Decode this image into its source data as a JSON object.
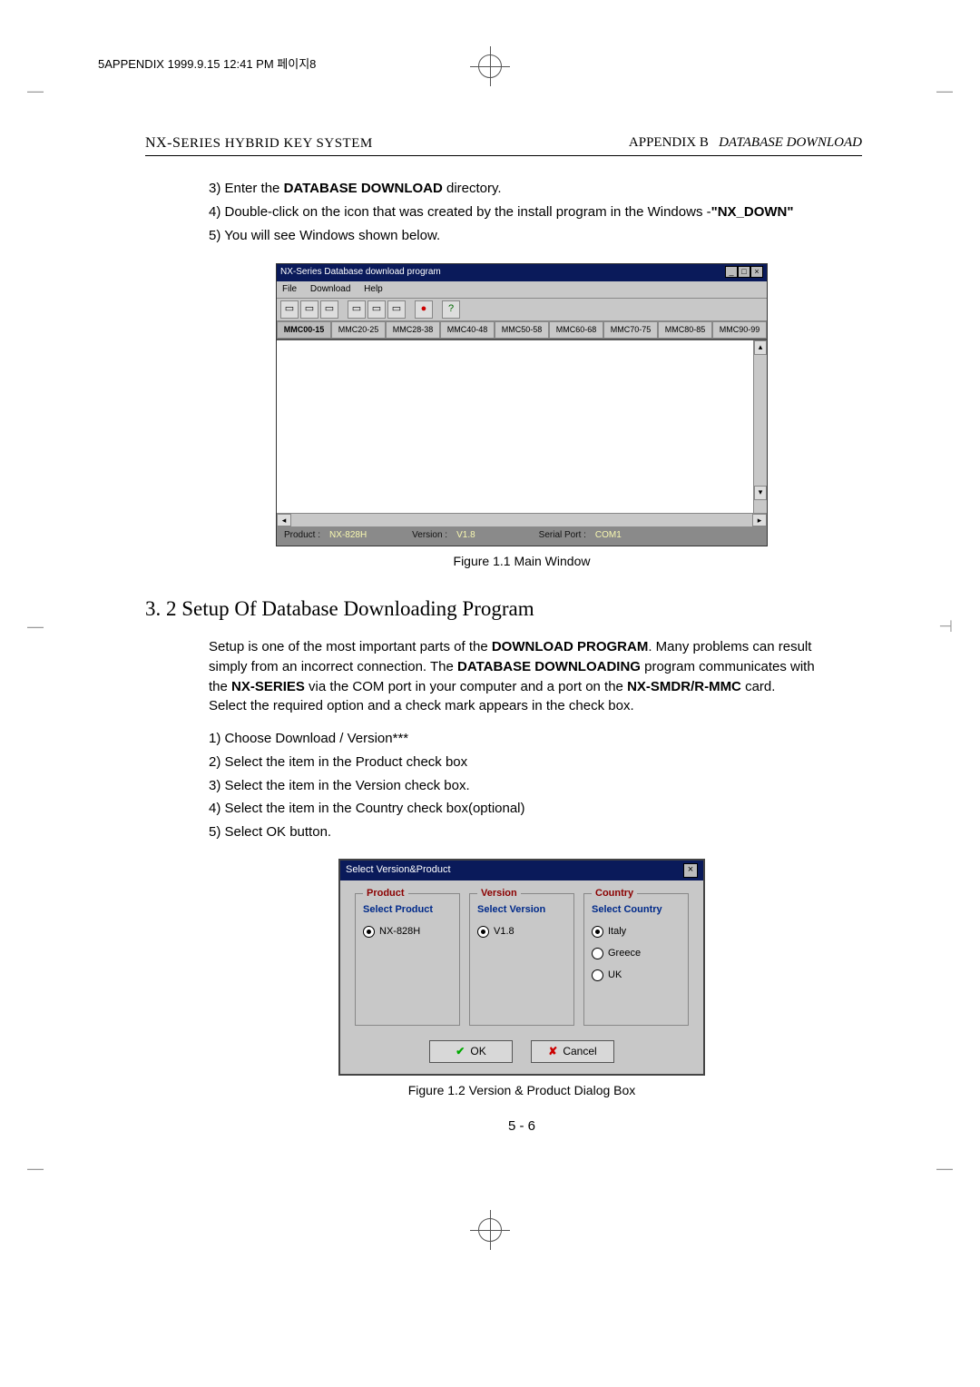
{
  "folio": "5APPENDIX  1999.9.15 12:41 PM  페이지8",
  "running_head": {
    "left_prefix": "NX-S",
    "left_rest": "ERIES",
    "left_tail": " HYBRID KEY SYSTEM",
    "right_prefix": "APPENDIX B",
    "right_italic": "DATABASE DOWNLOAD"
  },
  "steps_top": [
    {
      "n": "3)",
      "pre": " Enter the ",
      "bold": "DATABASE DOWNLOAD",
      "post": " directory."
    },
    {
      "n": "4)",
      "pre": " Double-click on the icon that was created by the install program in the Windows -",
      "bold": "\"NX_DOWN\"",
      "post": ""
    },
    {
      "n": "5)",
      "pre": " You will see Windows shown below.",
      "bold": "",
      "post": ""
    }
  ],
  "window1": {
    "title": "NX-Series Database download program",
    "menu": [
      "File",
      "Download",
      "Help"
    ],
    "tabs": [
      "MMC00-15",
      "MMC20-25",
      "MMC28-38",
      "MMC40-48",
      "MMC50-58",
      "MMC60-68",
      "MMC70-75",
      "MMC80-85",
      "MMC90-99"
    ],
    "status": {
      "product_label": "Product :",
      "product_value": "NX-828H",
      "version_label": "Version :",
      "version_value": "V1.8",
      "port_label": "Serial Port :",
      "port_value": "COM1"
    }
  },
  "fig1_caption": "Figure 1.1 Main Window",
  "section_title": "3. 2 Setup Of Database Downloading Program",
  "setup_para": {
    "p1a": "Setup is one of the most important parts of the ",
    "p1b": "DOWNLOAD PROGRAM",
    "p1c": ". Many problems can result simply from an incorrect connection. The ",
    "p1d": "DATABASE DOWNLOADING",
    "p1e": "  program communicates with the ",
    "p1f": "NX-SERIES",
    "p1g": " via the COM port in your computer and a port on the ",
    "p1h": "NX-SMDR/R-MMC",
    "p1i": " card.",
    "p2": "Select the required option and a check mark appears in the check box."
  },
  "steps_setup": [
    "1) Choose Download / Version***",
    "2) Select the item in the Product check box",
    "3) Select the item in the Version check box.",
    "4) Select the item in the Country check box(optional)",
    "5) Select  OK button."
  ],
  "dialog": {
    "title": "Select Version&Product",
    "product": {
      "legend": "Product",
      "sub": "Select Product",
      "options": [
        {
          "label": "NX-828H",
          "checked": true
        }
      ]
    },
    "version": {
      "legend": "Version",
      "sub": "Select Version",
      "options": [
        {
          "label": "V1.8",
          "checked": true
        }
      ]
    },
    "country": {
      "legend": "Country",
      "sub": "Select Country",
      "options": [
        {
          "label": "Italy",
          "checked": true
        },
        {
          "label": "Greece",
          "checked": false
        },
        {
          "label": "UK",
          "checked": false
        }
      ]
    },
    "ok": "OK",
    "cancel": "Cancel"
  },
  "fig2_caption": "Figure 1.2 Version & Product Dialog Box",
  "page_number": "5 - 6"
}
